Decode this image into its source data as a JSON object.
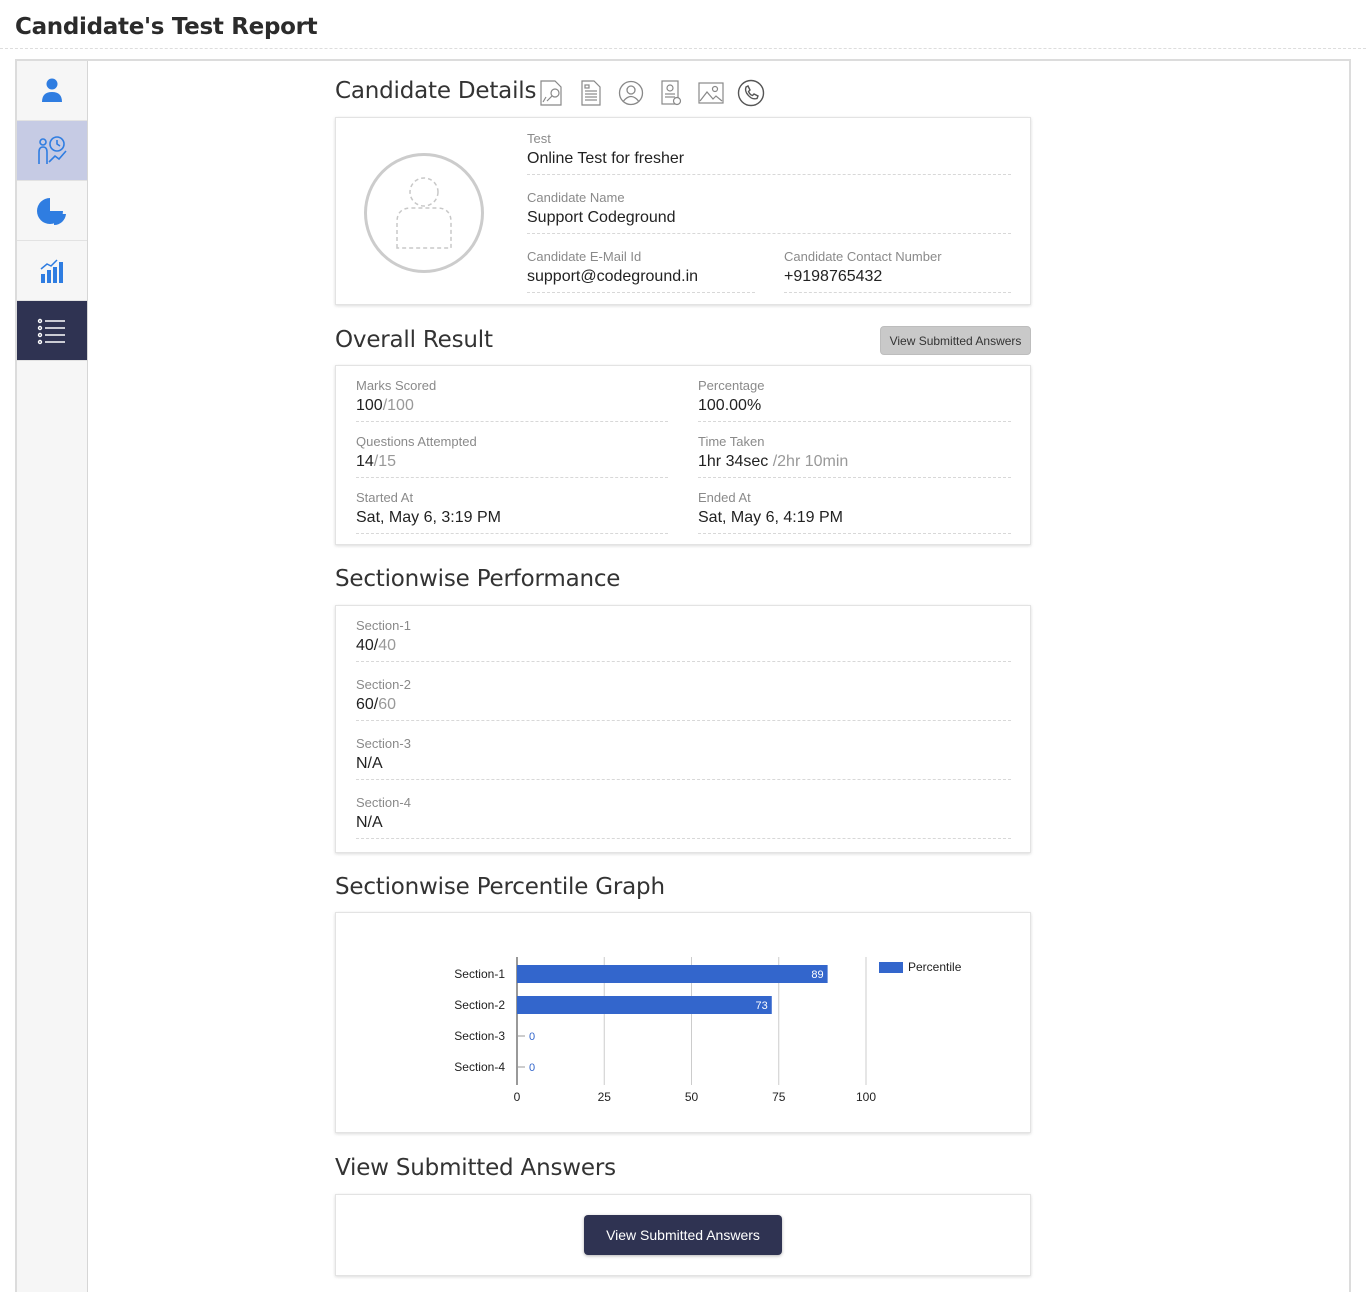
{
  "page": {
    "title": "Candidate's Test Report"
  },
  "sections": {
    "candidate_details": "Candidate Details",
    "overall_result": "Overall Result",
    "sectionwise_performance": "Sectionwise Performance",
    "sectionwise_percentile_graph": "Sectionwise Percentile Graph",
    "view_submitted_answers": "View Submitted Answers"
  },
  "candidate": {
    "test_label": "Test",
    "test_value": "Online Test for fresher",
    "name_label": "Candidate Name",
    "name_value": "Support Codeground",
    "email_label": "Candidate E-Mail Id",
    "email_value": "support@codeground.in",
    "contact_label": "Candidate Contact Number",
    "contact_value": "+9198765432"
  },
  "overall": {
    "view_button": "View Submitted Answers",
    "marks_label": "Marks Scored",
    "marks_value": "100",
    "marks_total": "/100",
    "percentage_label": "Percentage",
    "percentage_value": "100.00%",
    "questions_label": "Questions Attempted",
    "questions_value": "14",
    "questions_total": "/15",
    "time_label": "Time Taken",
    "time_value": "1hr 34sec",
    "time_total": " /2hr 10min",
    "started_label": "Started At",
    "started_value": "Sat, May 6, 3:19 PM",
    "ended_label": "Ended At",
    "ended_value": "Sat, May 6, 4:19 PM"
  },
  "performance": [
    {
      "label": "Section-1",
      "score": "40/",
      "total": "40"
    },
    {
      "label": "Section-2",
      "score": "60/",
      "total": "60"
    },
    {
      "label": "Section-3",
      "score": "N/A",
      "total": ""
    },
    {
      "label": "Section-4",
      "score": "N/A",
      "total": ""
    }
  ],
  "submitted": {
    "button": "View Submitted Answers"
  },
  "colors": {
    "bar": "#3366cc",
    "dark": "#2f3352",
    "accent": "#2f7de1"
  },
  "icons": {
    "sidebar": [
      "user-icon",
      "analytics-clock-icon",
      "pie-chart-icon",
      "bar-chart-icon",
      "list-icon"
    ],
    "details": [
      "pdf-search-icon",
      "document-icon",
      "profile-circle-icon",
      "id-card-icon",
      "image-icon",
      "phone-icon"
    ]
  },
  "chart_data": {
    "type": "bar",
    "orientation": "horizontal",
    "categories": [
      "Section-1",
      "Section-2",
      "Section-3",
      "Section-4"
    ],
    "series": [
      {
        "name": "Percentile",
        "values": [
          89,
          73,
          0,
          0
        ]
      }
    ],
    "xlim": [
      0,
      100
    ],
    "xticks": [
      0,
      25,
      50,
      75,
      100
    ],
    "grid": true,
    "legend": "right"
  }
}
